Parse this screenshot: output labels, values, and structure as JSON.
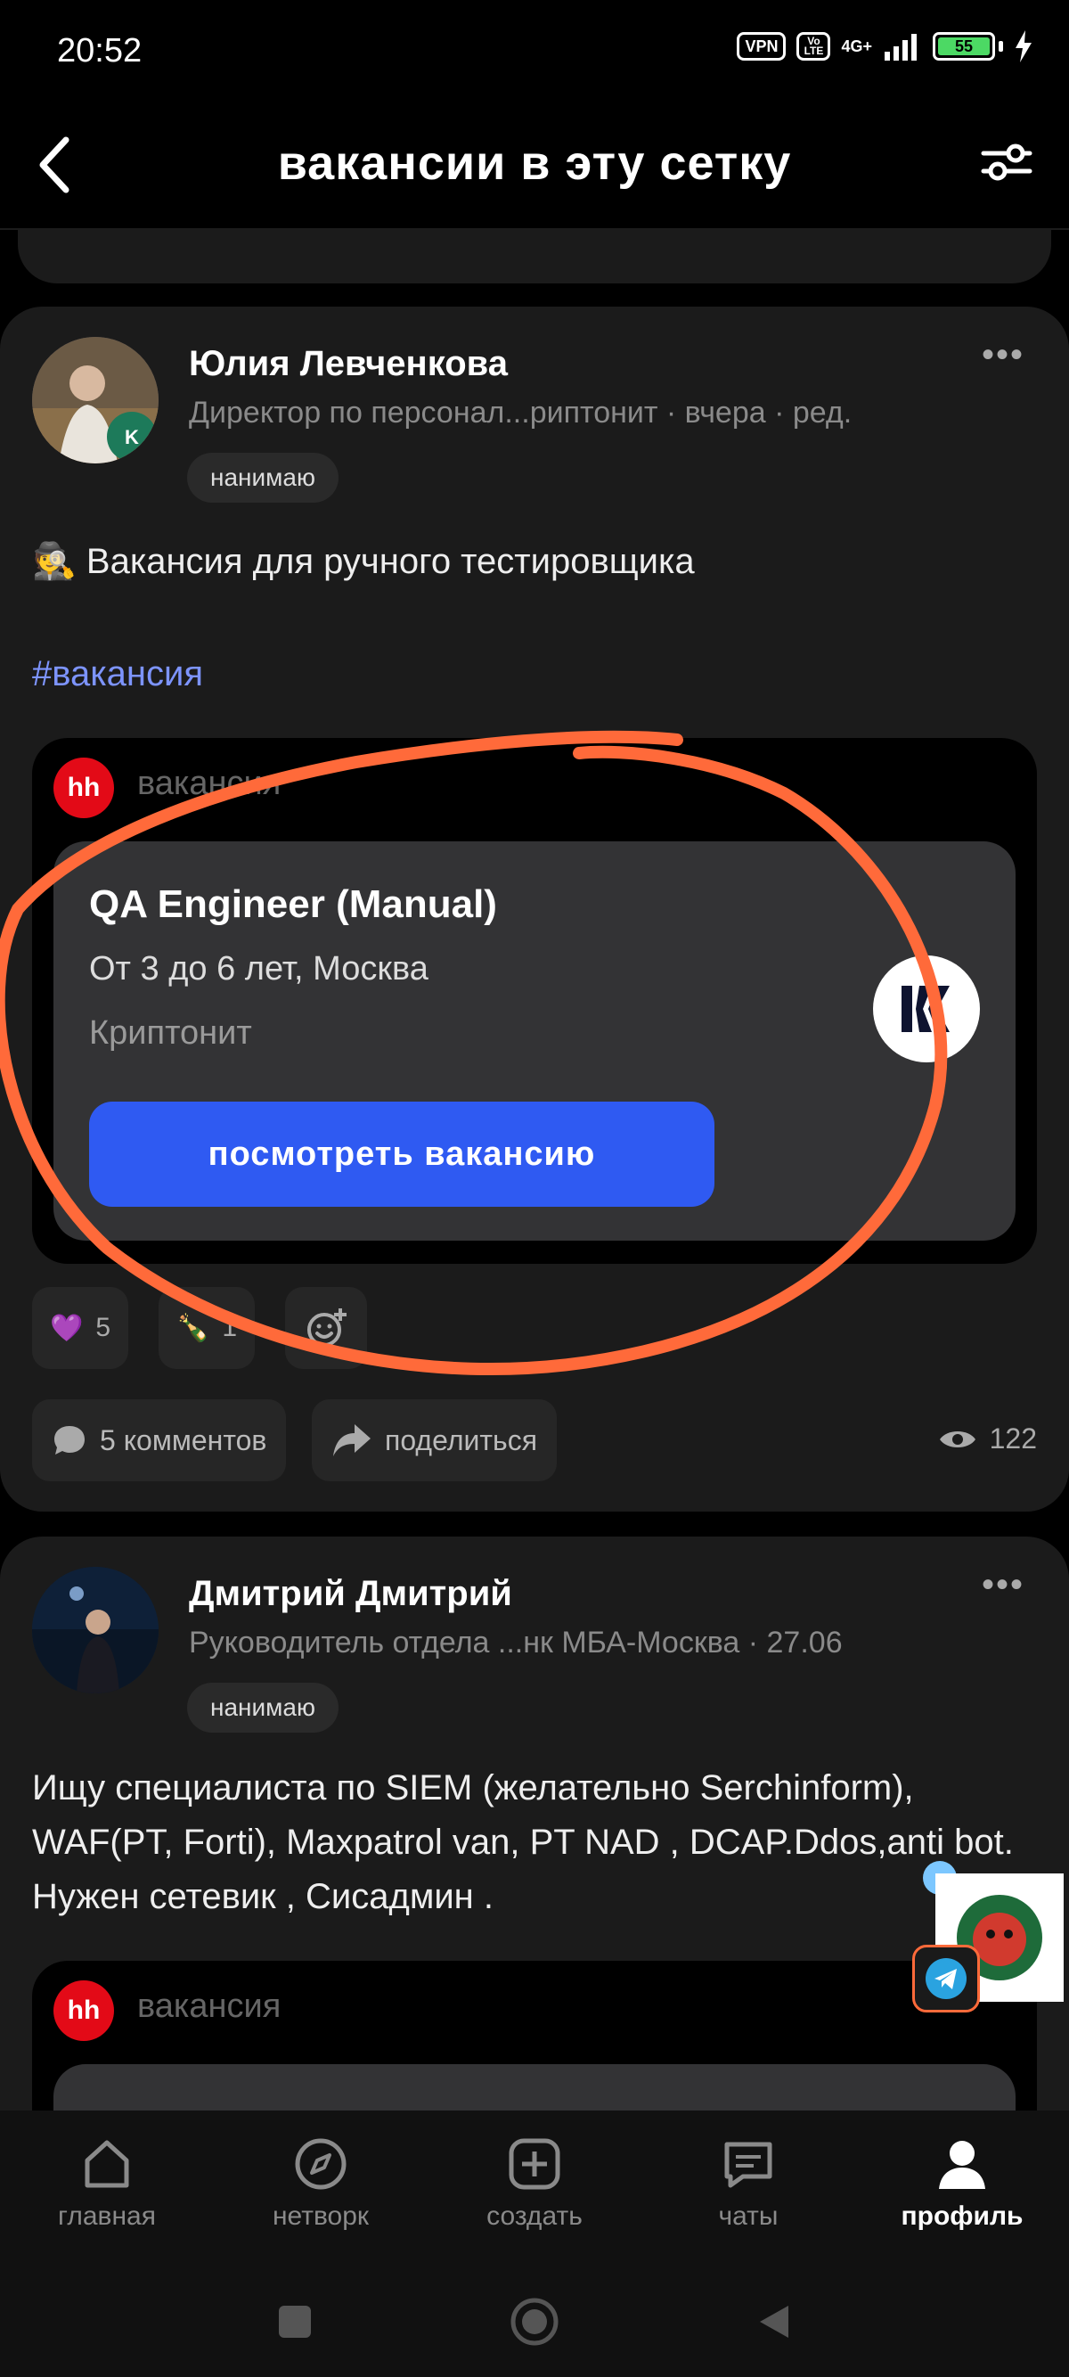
{
  "status_bar": {
    "time": "20:52",
    "vpn": "VPN",
    "volte": "Vo LTE",
    "network": "4G+",
    "battery": "55"
  },
  "header": {
    "title": "вакансии в эту сетку"
  },
  "post1": {
    "author": "Юлия Левченкова",
    "subtitle": "Директор по персонал...риптонит · вчера · ред.",
    "badge": "нанимаю",
    "text": "🕵️ Вакансия для ручного тестировщика",
    "hashtag": "#вакансия",
    "attachment": {
      "source": "hh",
      "label": "вакансия",
      "title": "QA Engineer (Manual)",
      "details": "От 3 до 6 лет, Москва",
      "company": "Криптонит",
      "button": "посмотреть вакансию"
    },
    "reactions": [
      {
        "emoji": "💜",
        "count": "5"
      },
      {
        "emoji": "🍾",
        "count": "1"
      }
    ],
    "comments": "5 комментов",
    "share": "поделиться",
    "views": "122"
  },
  "post2": {
    "author": "Дмитрий Дмитрий",
    "subtitle": "Руководитель отдела ...нк МБА-Москва · 27.06",
    "badge": "нанимаю",
    "text_lines": [
      "Ищу специалиста по SIEM (желательно Serchinform),",
      "WAF(PT, Forti), Maxpatrol van, PT NAD , DCAP.Ddos,anti bot.",
      "Нужен сетевик , Сисадмин ."
    ],
    "attachment": {
      "source": "hh",
      "label": "вакансия"
    }
  },
  "nav": [
    {
      "label": "главная",
      "icon": "home-icon"
    },
    {
      "label": "нетворк",
      "icon": "compass-icon"
    },
    {
      "label": "создать",
      "icon": "plus-square-icon"
    },
    {
      "label": "чаты",
      "icon": "chat-icon"
    },
    {
      "label": "профиль",
      "icon": "profile-icon",
      "active": true
    }
  ],
  "colors": {
    "accent": "#2f5af2",
    "hashtag": "#7d94ff",
    "annotation": "#ff6a3a",
    "hh": "#e30a17"
  }
}
